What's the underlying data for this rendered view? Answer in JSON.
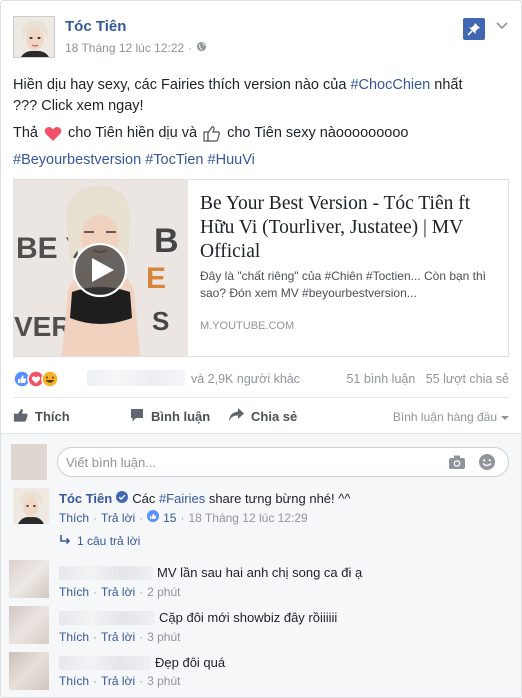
{
  "post": {
    "author": "Tóc Tiên",
    "timestamp": "18 Tháng 12 lúc 12:22",
    "dot": "·",
    "privacy_icon": "globe-icon",
    "line1": "Hiền dịu hay sexy, các Fairies thích version nào của ",
    "line1_tag": "#ChocChien",
    "line1_end": " nhất",
    "line2": "??? Click xem ngay!",
    "line3_a": "Thả ",
    "line3_b": " cho Tiên hiền dịu và ",
    "line3_c": " cho Tiên sexy nàooooooooo",
    "hashtags": [
      "#Beyourbestversion",
      "#TocTien",
      "#HuuVi"
    ]
  },
  "link_preview": {
    "title": "Be Your Best Version - Tóc Tiên ft Hữu Vi (Tourliver, Justatee) | MV Official",
    "description": "Đây là \"chất riêng\" của #Chiên #Toctien... Còn bạn thì sao? Đón xem MV #beyourbestversion...",
    "domain": "M.YOUTUBE.COM"
  },
  "reactions": {
    "others_text": "và 2,9K người khác",
    "comments_count": "51 bình luận",
    "shares_count": "55 lượt chia sẻ"
  },
  "actions": {
    "like": "Thích",
    "comment": "Bình luận",
    "share": "Chia sẻ",
    "sort": "Bình luận hàng đầu"
  },
  "composer": {
    "placeholder": "Viết bình luận..."
  },
  "comments": [
    {
      "author": "Tóc Tiên",
      "prefix": "Các ",
      "tag": "#Fairies",
      "text": " share tưng bừng nhé! ^^",
      "like": "Thích",
      "reply": "Trả lời",
      "reactions": "15",
      "time": "18 Tháng 12 lúc 12:29"
    },
    {
      "text": "MV lần sau hai anh chị song ca đi ạ",
      "like": "Thích",
      "reply": "Trả lời",
      "time": "2 phút"
    },
    {
      "text": "Cặp đôi mới showbiz đây rồiiiiii",
      "like": "Thích",
      "reply": "Trả lời",
      "time": "3 phút"
    },
    {
      "text": "Đẹp đôi quá",
      "like": "Thích",
      "reply": "Trả lời",
      "time": "3 phút"
    }
  ],
  "replies_link": "1 câu trả lời",
  "colors": {
    "link": "#365899",
    "muted": "#90949c",
    "accent": "#4267b2",
    "love": "#f25268"
  }
}
